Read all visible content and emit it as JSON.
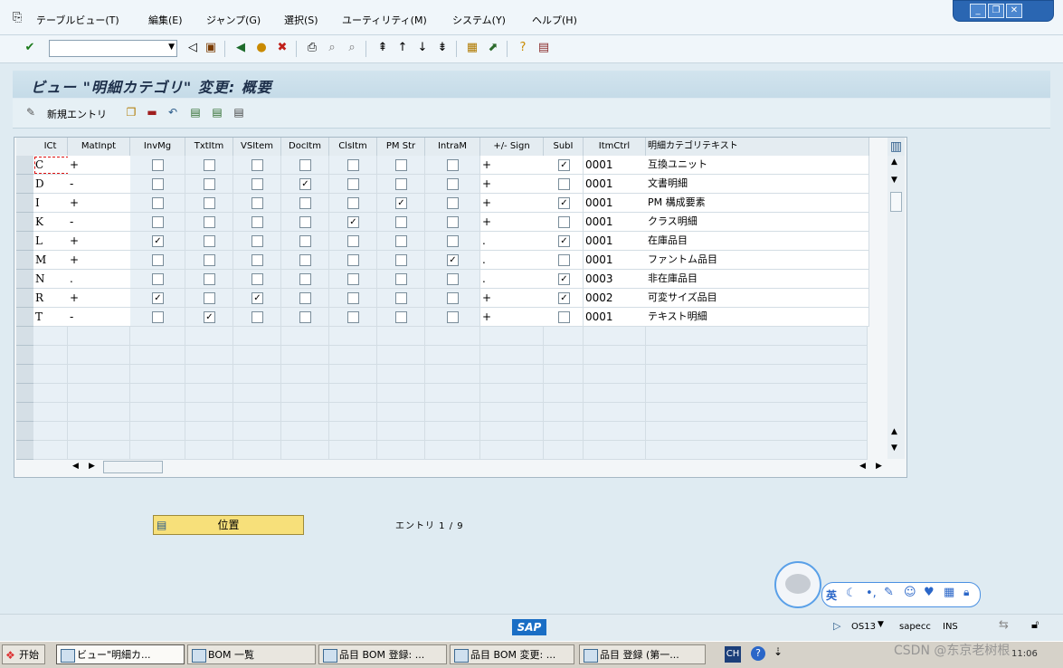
{
  "menubar": {
    "items": [
      "テーブルビュー(T)",
      "編集(E)",
      "ジャンプ(G)",
      "選択(S)",
      "ユーティリティ(M)",
      "システム(Y)",
      "ヘルプ(H)"
    ]
  },
  "toolbar": {
    "command_value": ""
  },
  "title": "ビュー \"明細カテゴリ\" 変更: 概要",
  "app_toolbar": {
    "new_entries_label": "新規エントリ"
  },
  "table": {
    "columns": [
      "ICt",
      "MatInpt",
      "InvMg",
      "TxtItm",
      "VSItem",
      "DocItm",
      "ClsItm",
      "PM Str",
      "IntraM",
      "+/- Sign",
      "SubI",
      "ItmCtrl",
      "明細カテゴリテキスト"
    ],
    "rows": [
      {
        "ict": "C",
        "matinpt": "+",
        "invmg": false,
        "txtitm": false,
        "vsitem": false,
        "docitm": false,
        "clsitm": false,
        "pmstr": false,
        "intram": false,
        "sign": "+",
        "subi": true,
        "itmctrl": "0001",
        "text": "互換ユニット"
      },
      {
        "ict": "D",
        "matinpt": "-",
        "invmg": false,
        "txtitm": false,
        "vsitem": false,
        "docitm": true,
        "clsitm": false,
        "pmstr": false,
        "intram": false,
        "sign": "+",
        "subi": false,
        "itmctrl": "0001",
        "text": "文書明細"
      },
      {
        "ict": "I",
        "matinpt": "+",
        "invmg": false,
        "txtitm": false,
        "vsitem": false,
        "docitm": false,
        "clsitm": false,
        "pmstr": true,
        "intram": false,
        "sign": "+",
        "subi": true,
        "itmctrl": "0001",
        "text": "PM 構成要素"
      },
      {
        "ict": "K",
        "matinpt": "-",
        "invmg": false,
        "txtitm": false,
        "vsitem": false,
        "docitm": false,
        "clsitm": true,
        "pmstr": false,
        "intram": false,
        "sign": "+",
        "subi": false,
        "itmctrl": "0001",
        "text": "クラス明細"
      },
      {
        "ict": "L",
        "matinpt": "+",
        "invmg": true,
        "txtitm": false,
        "vsitem": false,
        "docitm": false,
        "clsitm": false,
        "pmstr": false,
        "intram": false,
        "sign": ".",
        "subi": true,
        "itmctrl": "0001",
        "text": "在庫品目"
      },
      {
        "ict": "M",
        "matinpt": "+",
        "invmg": false,
        "txtitm": false,
        "vsitem": false,
        "docitm": false,
        "clsitm": false,
        "pmstr": false,
        "intram": true,
        "sign": ".",
        "subi": false,
        "itmctrl": "0001",
        "text": "ファントム品目"
      },
      {
        "ict": "N",
        "matinpt": ".",
        "invmg": false,
        "txtitm": false,
        "vsitem": false,
        "docitm": false,
        "clsitm": false,
        "pmstr": false,
        "intram": false,
        "sign": ".",
        "subi": true,
        "itmctrl": "0003",
        "text": "非在庫品目"
      },
      {
        "ict": "R",
        "matinpt": "+",
        "invmg": true,
        "txtitm": false,
        "vsitem": true,
        "docitm": false,
        "clsitm": false,
        "pmstr": false,
        "intram": false,
        "sign": "+",
        "subi": true,
        "itmctrl": "0002",
        "text": "可変サイズ品目"
      },
      {
        "ict": "T",
        "matinpt": "-",
        "invmg": false,
        "txtitm": true,
        "vsitem": false,
        "docitm": false,
        "clsitm": false,
        "pmstr": false,
        "intram": false,
        "sign": "+",
        "subi": false,
        "itmctrl": "0001",
        "text": "テキスト明細"
      }
    ]
  },
  "position_button": "位置",
  "entry_count": "エントリ 1 / 9",
  "status": {
    "system": "OS13",
    "server": "sapecc",
    "mode": "INS"
  },
  "ime": {
    "lang": "英"
  },
  "taskbar": {
    "start": "开始",
    "tasks": [
      "ビュー\"明細カ...",
      "BOM 一覧",
      "品目 BOM 登録: ...",
      "品目 BOM 変更: ...",
      "品目 登録 (第一..."
    ],
    "lang": "CH",
    "clock": "11:06"
  },
  "watermark": "CSDN @东京老树根",
  "logo": "SAP"
}
